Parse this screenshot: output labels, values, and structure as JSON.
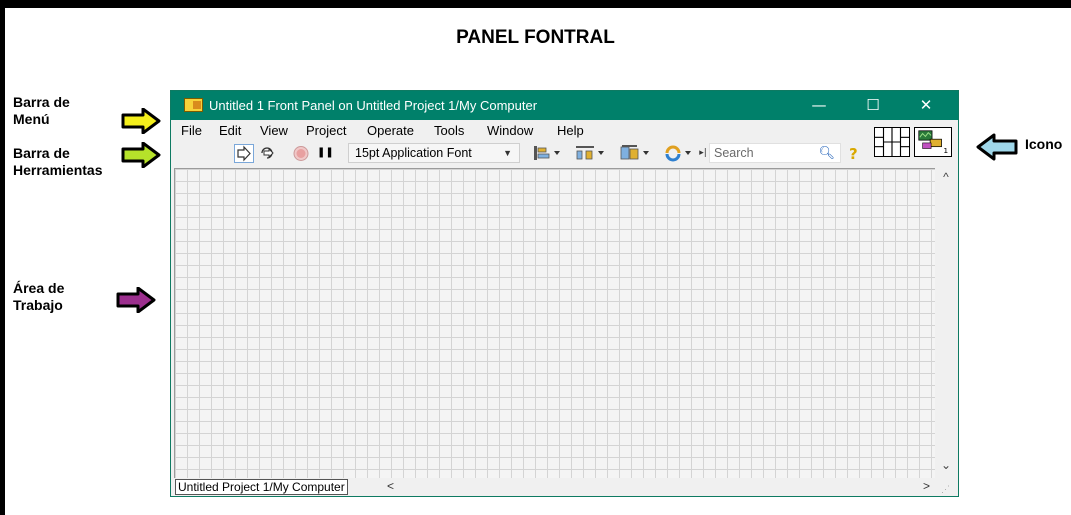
{
  "heading": "PANEL FONTRAL",
  "annotations": {
    "menu_bar_l1": "Barra de",
    "menu_bar_l2": "Menú",
    "toolbar_l1": "Barra de",
    "toolbar_l2": "Herramientas",
    "workarea_l1": "Área de",
    "workarea_l2": "Trabajo",
    "icon": "Icono"
  },
  "arrow_colors": {
    "menu": "#f4ef1c",
    "toolbar": "#b6e22a",
    "workarea": "#9c2f8e",
    "icon": "#9fd7ea"
  },
  "window": {
    "title": "Untitled 1 Front Panel on Untitled Project 1/My Computer",
    "titlebar_color": "#00806a",
    "controls": [
      "minimize-icon",
      "maximize-icon",
      "close-icon"
    ],
    "minimize_glyph": "—",
    "maximize_glyph": "☐",
    "close_glyph": "✕"
  },
  "menu": {
    "items": [
      "File",
      "Edit",
      "View",
      "Project",
      "Operate",
      "Tools",
      "Window",
      "Help"
    ]
  },
  "toolbar": {
    "tools": [
      "run-arrow-icon",
      "run-continuously-icon",
      "abort-icon",
      "pause-icon",
      "align-objects-icon",
      "distribute-objects-icon",
      "resize-objects-icon",
      "reorder-icon",
      "cleanup-icon"
    ],
    "pause_glyph": "❚❚",
    "font_select": "15pt Application Font",
    "search_placeholder": "Search",
    "help_glyph": "?"
  },
  "status": {
    "context": "Untitled Project 1/My Computer"
  },
  "scroll": {
    "up": "^",
    "down": "⌄",
    "left": "<",
    "right": ">"
  }
}
